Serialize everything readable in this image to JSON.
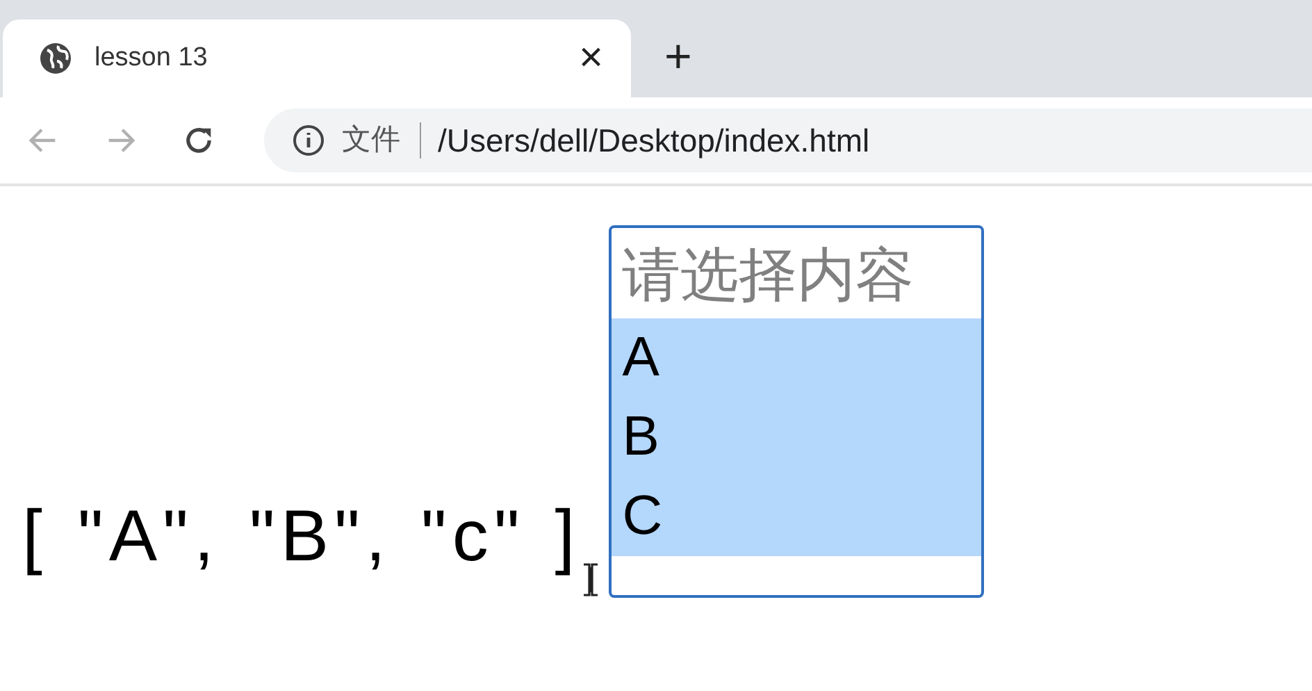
{
  "tab": {
    "title": "lesson 13",
    "close": "×",
    "new_tab": "+",
    "selected": true
  },
  "address_bar": {
    "scheme_label": "文件",
    "url": "/Users/dell/Desktop/index.html"
  },
  "page": {
    "output_text": "[ \"A\", \"B\", \"c\" ]",
    "listbox": {
      "options": [
        {
          "label": "请选择内容",
          "disabled": true,
          "selected": false
        },
        {
          "label": "A",
          "disabled": false,
          "selected": true
        },
        {
          "label": "B",
          "disabled": false,
          "selected": true
        },
        {
          "label": "C",
          "disabled": false,
          "selected": true
        }
      ]
    }
  }
}
